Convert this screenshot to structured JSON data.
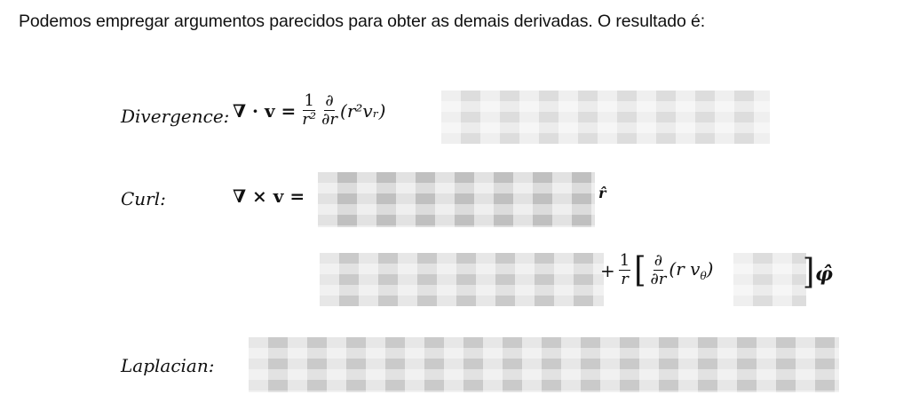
{
  "intro": "Podemos empregar argumentos parecidos para obter as demais derivadas. O resultado é:",
  "divergence": {
    "label": "Divergence:",
    "lhs": "∇ · v =",
    "frac_num": "1",
    "frac_den": "r²",
    "partial_num": "∂",
    "partial_den": "∂r",
    "term": "(r²vᵣ)"
  },
  "curl": {
    "label": "Curl:",
    "lhs": "∇ × v =",
    "line2_plus": "+",
    "line2_frac_num": "1",
    "line2_frac_den": "r",
    "line2_partial_num": "∂",
    "line2_partial_den": "∂r",
    "line2_term": "(r v",
    "line2_sub": "θ",
    "line2_close": ")",
    "unit_r": "r̂",
    "unit_phi": "φ̂"
  },
  "laplacian": {
    "label": "Laplacian:"
  }
}
